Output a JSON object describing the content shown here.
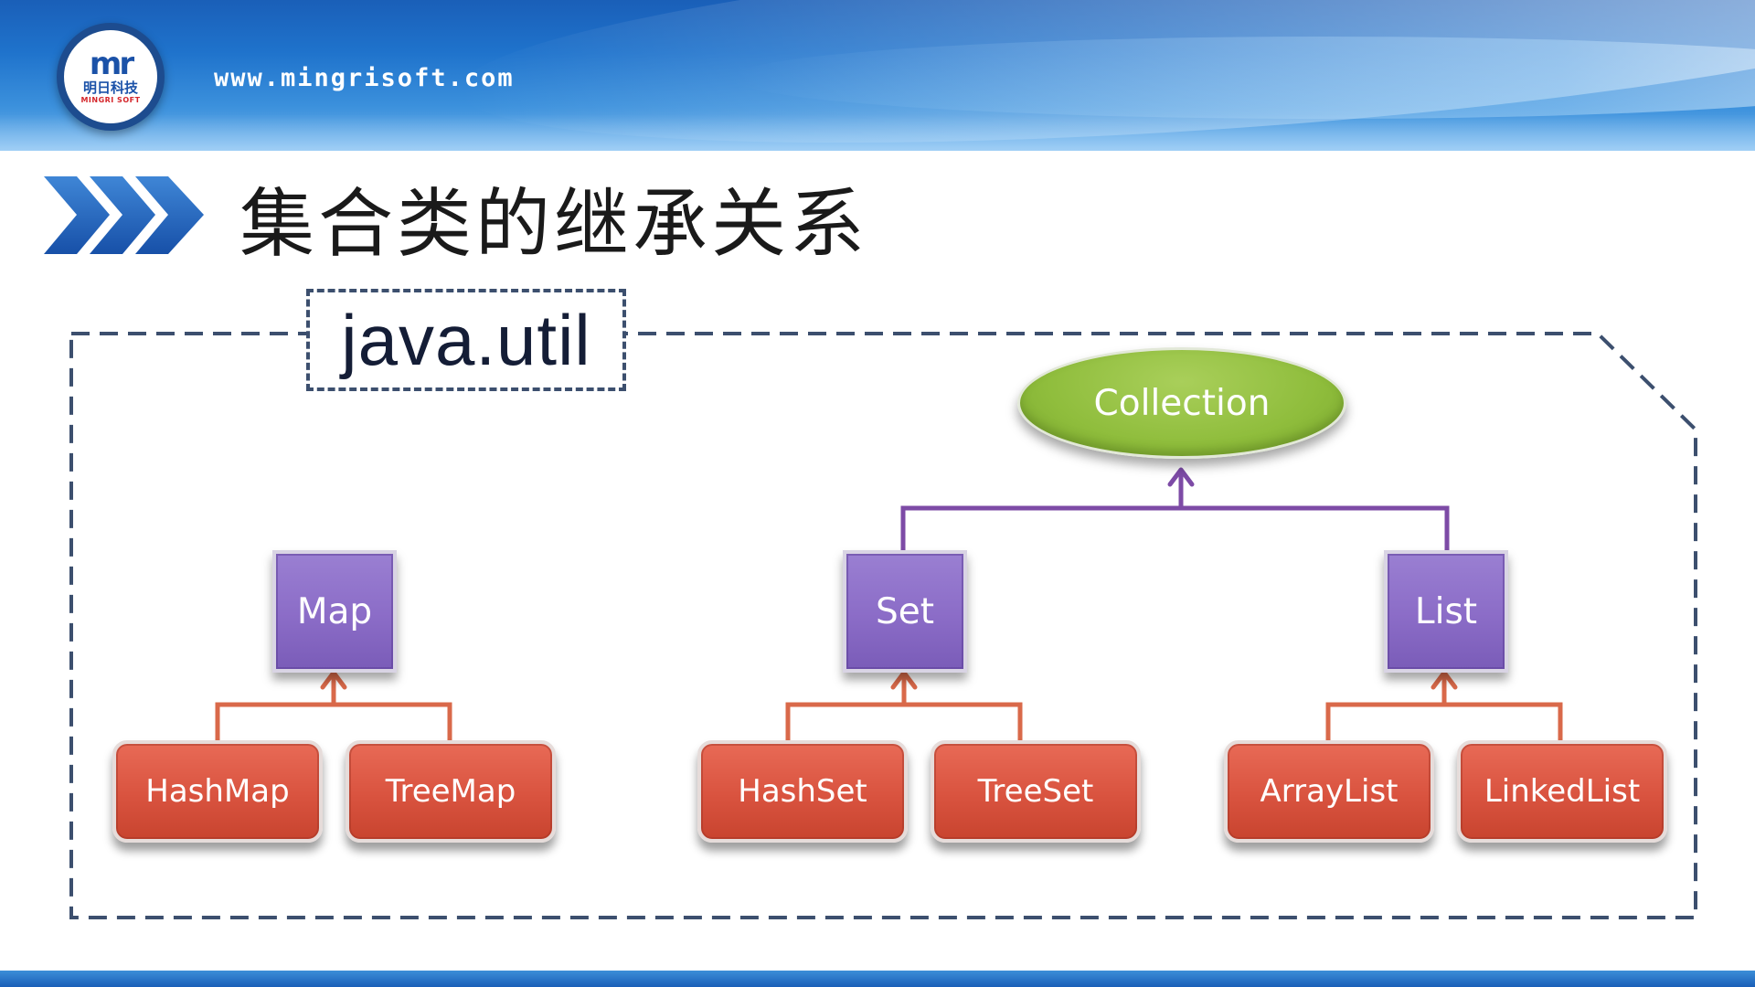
{
  "header": {
    "logo": {
      "mark": "mr",
      "cn": "明日科技",
      "en": "MINGRI SOFT"
    },
    "site_url": "www.mingrisoft.com"
  },
  "title": "集合类的继承关系",
  "diagram": {
    "package_label": "java.util",
    "root": "Collection",
    "interfaces": {
      "map": "Map",
      "set": "Set",
      "list": "List"
    },
    "classes": {
      "hashmap": "HashMap",
      "treemap": "TreeMap",
      "hashset": "HashSet",
      "treeset": "TreeSet",
      "arraylist": "ArrayList",
      "linkedlist": "LinkedList"
    },
    "colors": {
      "root": "#8fbd3c",
      "interface": "#8b6cc7",
      "class": "#d9533f",
      "interface_link": "#7d4ba6",
      "class_link": "#d9694a",
      "boundary": "#3c4f6e"
    }
  }
}
